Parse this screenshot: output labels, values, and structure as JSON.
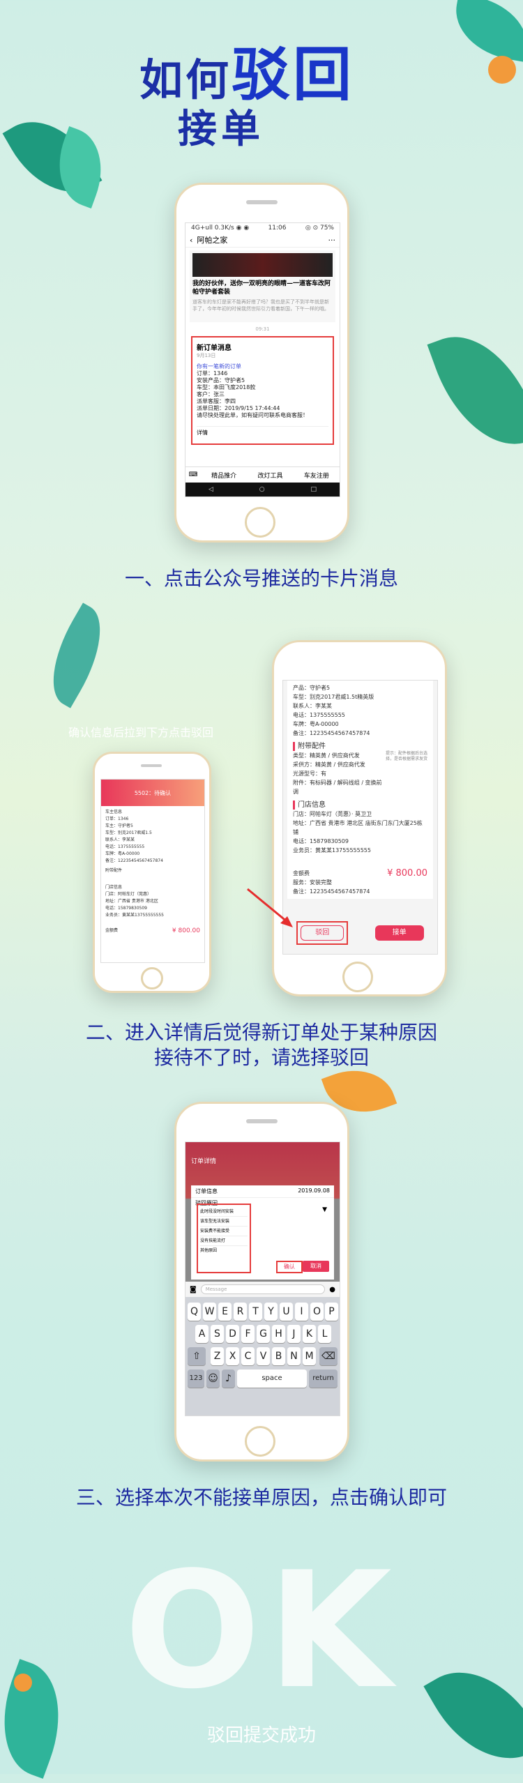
{
  "header": {
    "title_prefix": "如何",
    "title_emph": "驳回",
    "title_line2": "接单"
  },
  "step1": {
    "caption": "一、点击公众号推送的卡片消息",
    "status": {
      "carrier": "4G+ull 0.3K/s ◉ ◉",
      "time": "11:06",
      "battery": "◎ ⊙ 75%"
    },
    "nav_title": "阿帕之家",
    "article": {
      "headline": "我的好伙伴，送你一双明亮的眼睛—一道客车改阿帕守护者套装",
      "desc": "道客车的车灯是家不能再好搭了吗？我也是买了不到半年就是新手了，今年年初的时候我然世际引力看着新国，下午一样的哦。"
    },
    "divider_time": "09:31",
    "card": {
      "title": "新订单消息",
      "date": "9月13日",
      "link": "你有一笔新的订单",
      "lines": [
        "订单：1346",
        "安装产品：守护者5",
        "车型：本田飞度2018款",
        "客户：张三",
        "派单客服：李四",
        "派单日期：2019/9/15 17:44:44",
        "请尽快处理此单，如有疑问可联系电商客服！"
      ],
      "detail": "详情"
    },
    "menu": [
      "精品推介",
      "改灯工具",
      "车友注册"
    ]
  },
  "step2": {
    "caption_line1": "二、进入详情后觉得新订单处于某种原因",
    "caption_line2": "接待不了时，请选择驳回",
    "hint": "确认信息后拉到下方点击驳回",
    "small_header": "5502：待确认",
    "small_lines": [
      "车主信息",
      "订单：1346",
      "车主：守护者5",
      "车型：别克2017君威1.5",
      "联系人：李某某",
      "电话：1375555555",
      "车牌：粤A-00000",
      "备注：12235454567457874",
      "附带配件",
      "门店信息",
      "门店：阿帕车灯（莞惠）",
      "地址：广西省 贵港市 港北区",
      "电话：15879830509",
      "业务员：黄某某13755555555"
    ],
    "small_amount_label": "金额费",
    "small_amount": "¥ 800.00",
    "big": {
      "product": "产品：守护者5",
      "car": "车型：别克2017君威1.5t精英版",
      "contact": "联系人：李某某",
      "phone": "电话：1375555555",
      "plate": "车牌：粤A-00000",
      "note": "备注：12235454567457874",
      "parts_title": "附带配件",
      "parts": [
        "类型：精英黄  /  供应商代发",
        "采供方：精英黄  /  供应商代发",
        "光源型号：有",
        "附件：有标码器 / 解码线组 / 变换前调"
      ],
      "parts_hint": "提示：配件根据后台选择，是否根据需求发货",
      "store_title": "门店信息",
      "store": [
        "门店：阿帕车灯（莞惠）· 莫卫卫",
        "地址：广西省 贵港市 港北区 庙街东门东门大厦25栋铺",
        "电话：15879830509",
        "业务员：黄某某13755555555"
      ],
      "amount_label": "金额费",
      "amount": "¥ 800.00",
      "service_label": "服务：安装完整",
      "remark_label": "备注：12235454567457874",
      "reject_btn": "驳回",
      "accept_btn": "接单"
    }
  },
  "step3": {
    "caption": "三、选择本次不能接单原因，点击确认即可",
    "nav_title": "订单详情",
    "modal_title": "订单信息",
    "modal_date": "2019.09.08",
    "reason_label": "驳回原因",
    "options": [
      "此时段没时间安装",
      "该车型无法安装",
      "安装费不能接受",
      "没有技能流打",
      "其他原因"
    ],
    "confirm": "确认",
    "cancel": "取消",
    "message_placeholder": "Message",
    "keys_row1": [
      "Q",
      "W",
      "E",
      "R",
      "T",
      "Y",
      "U",
      "I",
      "O",
      "P"
    ],
    "keys_row2": [
      "A",
      "S",
      "D",
      "F",
      "G",
      "H",
      "J",
      "K",
      "L"
    ],
    "keys_row3": [
      "Z",
      "X",
      "C",
      "V",
      "B",
      "N",
      "M"
    ],
    "key_123": "123",
    "key_space": "space",
    "key_return": "return"
  },
  "footer": {
    "ok": "OK",
    "done": "驳回提交成功"
  },
  "colors": {
    "title": "#1b2fa6",
    "caption": "#1d2aa0",
    "accent_red": "#e8375a",
    "box_red": "#e53b3b"
  }
}
